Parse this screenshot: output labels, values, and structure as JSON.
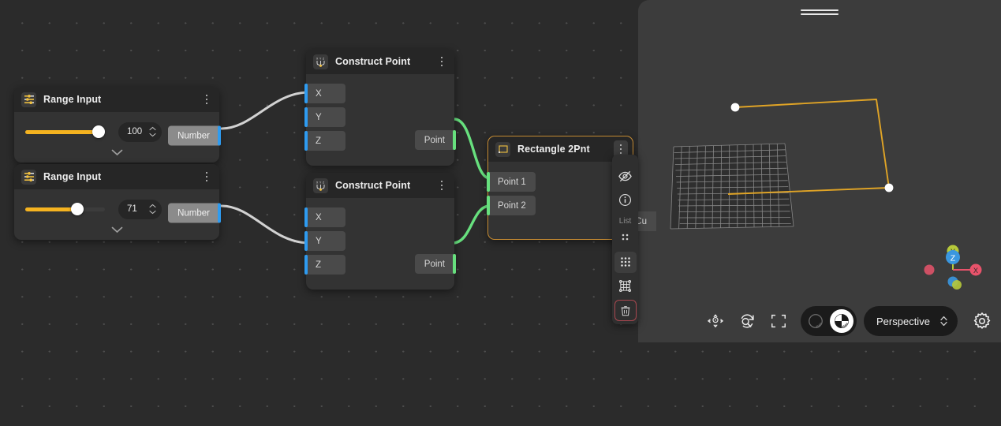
{
  "app": {
    "canvas_name": "node-graph-canvas"
  },
  "nodes": [
    {
      "id": "range-input-1",
      "title": "Range Input",
      "icon": "sliders-icon",
      "value": "100",
      "slider_percent": 92,
      "output_label": "Number",
      "menu_icon": "kebab-menu-icon",
      "expand_icon": "chevron-down-icon"
    },
    {
      "id": "range-input-2",
      "title": "Range Input",
      "icon": "sliders-icon",
      "value": "71",
      "slider_percent": 65,
      "output_label": "Number",
      "menu_icon": "kebab-menu-icon",
      "expand_icon": "chevron-down-icon"
    },
    {
      "id": "construct-point-1",
      "title": "Construct Point",
      "icon": "xyz-point-icon",
      "inputs": [
        "X",
        "Y",
        "Z"
      ],
      "outputs": [
        "Point"
      ],
      "menu_icon": "kebab-menu-icon"
    },
    {
      "id": "construct-point-2",
      "title": "Construct Point",
      "icon": "xyz-point-icon",
      "inputs": [
        "X",
        "Y",
        "Z"
      ],
      "outputs": [
        "Point"
      ],
      "menu_icon": "kebab-menu-icon"
    },
    {
      "id": "rectangle-2pnt",
      "title": "Rectangle 2Pnt",
      "icon": "rectangle-icon",
      "inputs": [
        "Point 1",
        "Point 2"
      ],
      "outputs": [
        "Cu"
      ],
      "menu_icon": "kebab-menu-icon",
      "selected": true
    }
  ],
  "node_toolbar": {
    "name": "node-context-toolbar",
    "items": [
      {
        "name": "visibility-off-icon",
        "label": ""
      },
      {
        "name": "info-icon",
        "label": ""
      },
      {
        "name": "list-label",
        "label": "List "
      },
      {
        "name": "dots-2x2-icon",
        "label": ""
      },
      {
        "name": "dots-3x3-icon",
        "label": ""
      },
      {
        "name": "grid-mesh-icon",
        "label": ""
      },
      {
        "name": "trash-icon",
        "label": ""
      }
    ]
  },
  "viewport": {
    "name": "3d-viewport",
    "drag_handle": "panel-drag-handle",
    "toolbar": {
      "pan_icon": "pan-orbit-icon",
      "rotate_icon": "rotate-zoom-icon",
      "fit_icon": "fit-to-screen-icon",
      "shading": [
        {
          "name": "wireframe-shading-icon",
          "selected": false
        },
        {
          "name": "shaded-shading-icon",
          "selected": true
        }
      ],
      "camera_mode": "Perspective",
      "camera_chevron_icon": "chevron-updown-icon",
      "settings_icon": "gear-icon"
    },
    "axis_gizmo": {
      "name": "axis-gizmo",
      "axes": [
        {
          "label": "Y",
          "color": "#b6c93a"
        },
        {
          "label": "Z",
          "color": "#3a97e0"
        },
        {
          "label": "X",
          "color": "#e8536b"
        }
      ]
    },
    "geometry": {
      "curve_color": "#e0a426",
      "point_color": "#ffffff",
      "grid_color": "#8d8d8d"
    }
  },
  "colors": {
    "accent_yellow": "#f5b320",
    "socket_blue": "#2e9bf0",
    "socket_green": "#67e07e",
    "selection_orange": "#c58b33",
    "danger_red": "#a8474f"
  }
}
